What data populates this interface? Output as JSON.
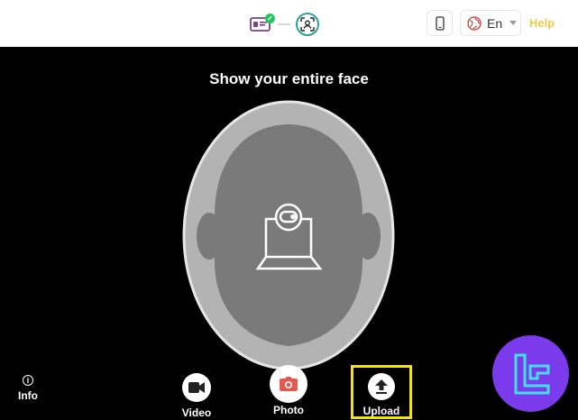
{
  "topbar": {
    "steps": [
      {
        "icon": "id-card-icon",
        "completed": true
      },
      {
        "icon": "face-scan-icon",
        "active": true
      }
    ],
    "device_icon": "phone-icon",
    "language": {
      "icon": "globe-icon",
      "label": "En"
    },
    "help_label": "Help",
    "help_color": "#f2c94c"
  },
  "main": {
    "title": "Show your entire face",
    "camera_icon": "laptop-webcam-icon"
  },
  "controls": {
    "info_label": "Info",
    "video_label": "Video",
    "photo_label": "Photo",
    "upload_label": "Upload",
    "highlight_color": "#f5e20a",
    "photo_icon_color": "#e05a4f"
  },
  "brand": {
    "logo_icon": "brand-logo-icon",
    "color": "#7c3aed"
  }
}
